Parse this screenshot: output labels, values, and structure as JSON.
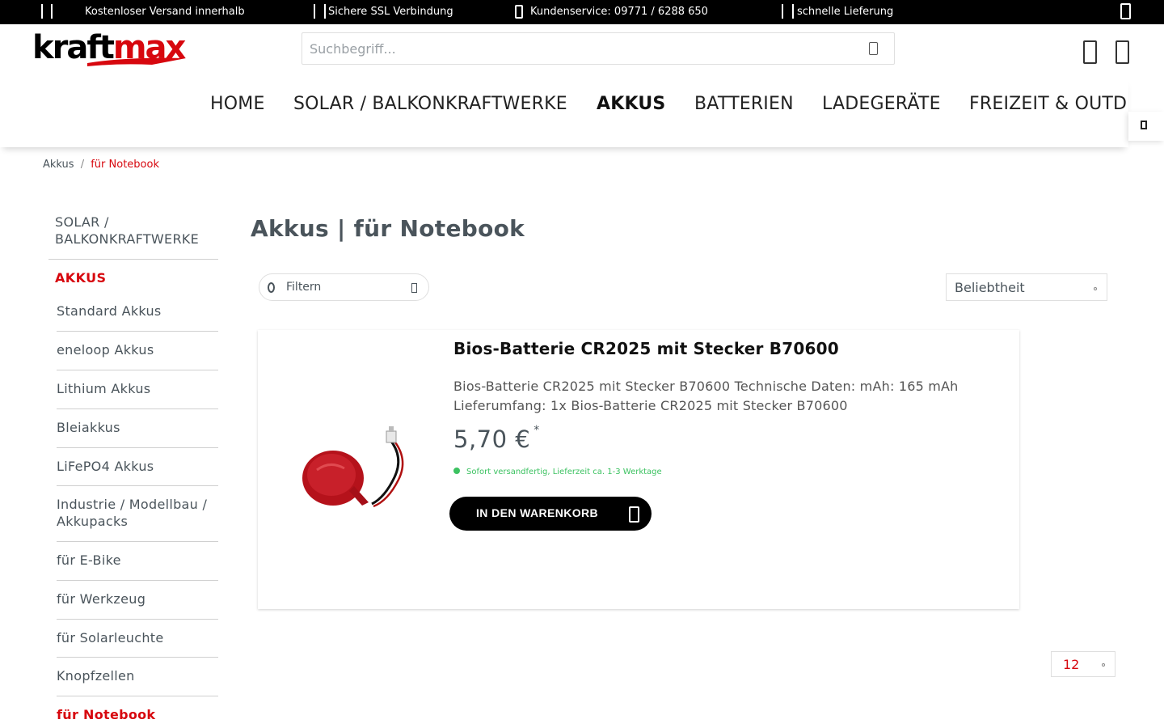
{
  "topbar": {
    "shipping_text": "Kostenloser Versand innerhalb",
    "ssl_text": "Sichere SSL Verbindung",
    "service_text": "Kundenservice: 09771 / 6288 650",
    "delivery_text": "schnelle Lieferung"
  },
  "header": {
    "logo_text_black": "kraft",
    "logo_text_red": "max",
    "search_placeholder": "Suchbegriff..."
  },
  "nav": {
    "items": [
      {
        "label": "HOME"
      },
      {
        "label": "SOLAR / BALKONKRAFTWERKE"
      },
      {
        "label": "AKKUS"
      },
      {
        "label": "BATTERIEN"
      },
      {
        "label": "LADEGERÄTE"
      },
      {
        "label": "FREIZEIT & OUTD"
      }
    ]
  },
  "breadcrumb": {
    "parent": "Akkus",
    "divider": "/",
    "current": "für Notebook"
  },
  "sidebar": {
    "top_category": "SOLAR / BALKONKRAFTWERKE",
    "active_category": "AKKUS",
    "subcategories": [
      {
        "label": "Standard Akkus"
      },
      {
        "label": "eneloop Akkus"
      },
      {
        "label": "Lithium Akkus"
      },
      {
        "label": "Bleiakkus"
      },
      {
        "label": "LiFePO4 Akkus"
      },
      {
        "label": "Industrie / Modellbau / Akkupacks"
      },
      {
        "label": "für E-Bike"
      },
      {
        "label": "für Werkzeug"
      },
      {
        "label": "für Solarleuchte"
      },
      {
        "label": "Knopfzellen"
      },
      {
        "label": "für Notebook"
      }
    ]
  },
  "main": {
    "title": "Akkus | für Notebook",
    "filter_label": "Filtern",
    "sort_label": "Beliebtheit",
    "per_page": "12"
  },
  "product": {
    "title": "Bios-Batterie CR2025 mit Stecker B70600",
    "description": "Bios-Batterie CR2025 mit Stecker B70600 Technische Daten: mAh: 165 mAh Lieferumfang: 1x Bios-Batterie CR2025 mit Stecker B70600",
    "price": "5,70 €",
    "price_note": "*",
    "delivery": "Sofort versandfertig, Lieferzeit ca. 1-3 Werktage",
    "cart_label": "IN DEN WARENKORB"
  },
  "colors": {
    "brand_red": "#d7070e",
    "in_stock_green": "#3cc261"
  }
}
